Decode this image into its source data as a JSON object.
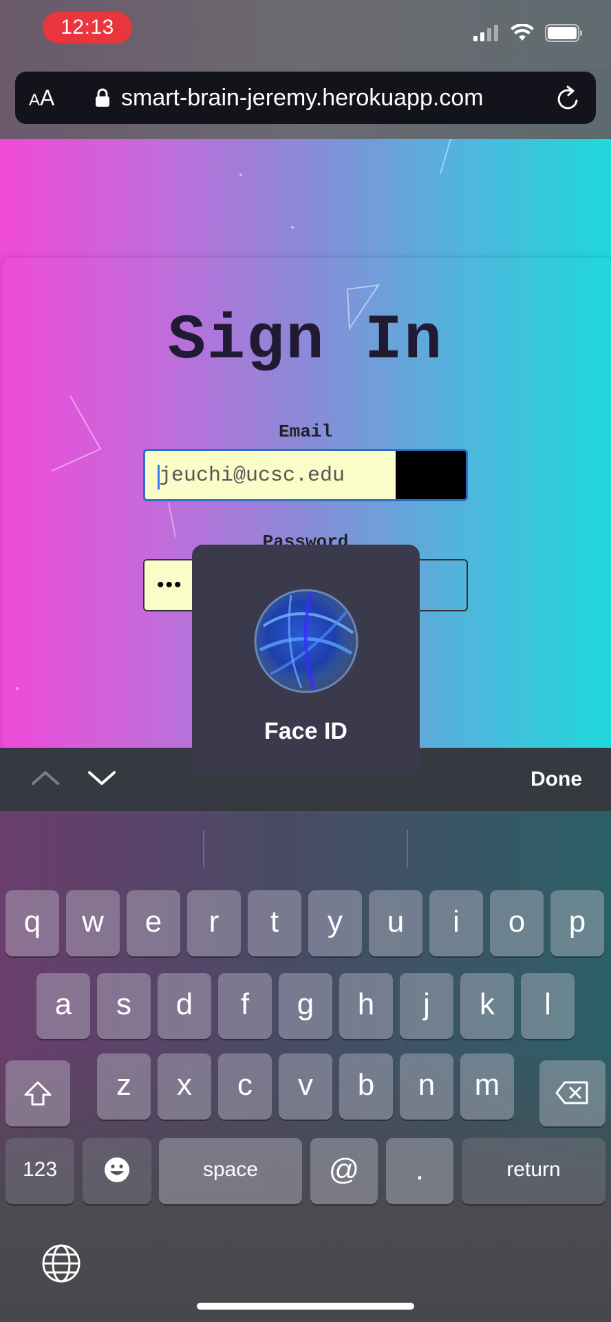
{
  "status_bar": {
    "time": "12:13"
  },
  "browser": {
    "text_size_label_small": "A",
    "text_size_label_large": "A",
    "url": "smart-brain-jeremy.herokuapp.com"
  },
  "page": {
    "title": "Sign In",
    "email_label": "Email",
    "email_value": "jeuchi@ucsc.edu",
    "password_label": "Password",
    "password_dots": "•••"
  },
  "faceid": {
    "label": "Face ID"
  },
  "accessory": {
    "done_label": "Done"
  },
  "keyboard": {
    "row1": [
      "q",
      "w",
      "e",
      "r",
      "t",
      "y",
      "u",
      "i",
      "o",
      "p"
    ],
    "row2": [
      "a",
      "s",
      "d",
      "f",
      "g",
      "h",
      "j",
      "k",
      "l"
    ],
    "row3": [
      "z",
      "x",
      "c",
      "v",
      "b",
      "n",
      "m"
    ],
    "numbers_label": "123",
    "space_label": "space",
    "at_label": "@",
    "period_label": ".",
    "return_label": "return"
  },
  "colors": {
    "time_pill": "#e8363c",
    "gradient_left": "#f04ad9",
    "gradient_right": "#1fd8dc",
    "input_fill": "#fbfdc8"
  }
}
